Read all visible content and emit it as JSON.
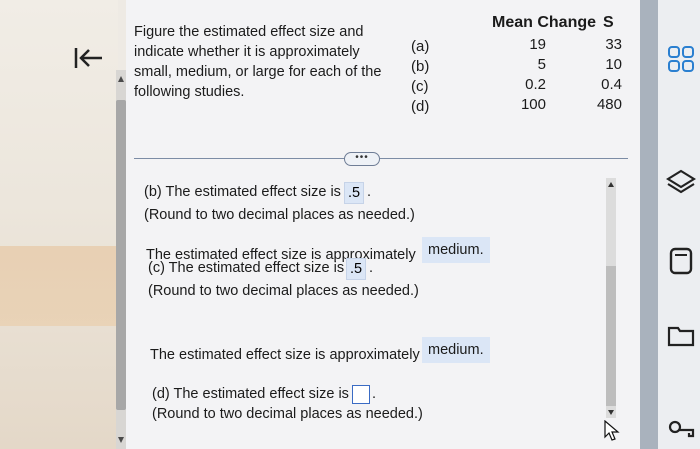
{
  "question": {
    "text": "Figure the estimated effect size and indicate whether it is approximately small, medium, or large for each of the following studies."
  },
  "table": {
    "headers": [
      "Mean Change",
      "S"
    ],
    "rows": [
      {
        "label": "(a)",
        "mean_change": "19",
        "s": "33"
      },
      {
        "label": "(b)",
        "mean_change": "5",
        "s": "10"
      },
      {
        "label": "(c)",
        "mean_change": "0.2",
        "s": "0.4"
      },
      {
        "label": "(d)",
        "mean_change": "100",
        "s": "480"
      }
    ]
  },
  "more_button": {
    "label": "•••"
  },
  "part_b": {
    "prefix": "(b) The estimated effect size is",
    "value": ".5",
    "suffix": ".",
    "hint": "(Round to two decimal places as needed.)",
    "size_prefix": "The estimated effect size is approximately",
    "size_value": "medium."
  },
  "part_c": {
    "prefix": "(c) The estimated effect size is",
    "value": ".5",
    "suffix": ".",
    "hint": "(Round to two decimal places as needed.)",
    "size_prefix": "The estimated effect size is approximately",
    "size_value": "medium."
  },
  "part_d": {
    "prefix": "(d) The estimated effect size is",
    "value": "",
    "suffix": ".",
    "hint": "(Round to two decimal places as needed.)"
  },
  "icons": {
    "back": "back-to-start-icon",
    "right_panel": [
      "grid-icon",
      "layers-icon",
      "calculator-icon",
      "folder-icon",
      "key-icon"
    ]
  },
  "colors": {
    "answer_highlight": "#dbe6f6",
    "input_border": "#3a6bc4"
  }
}
